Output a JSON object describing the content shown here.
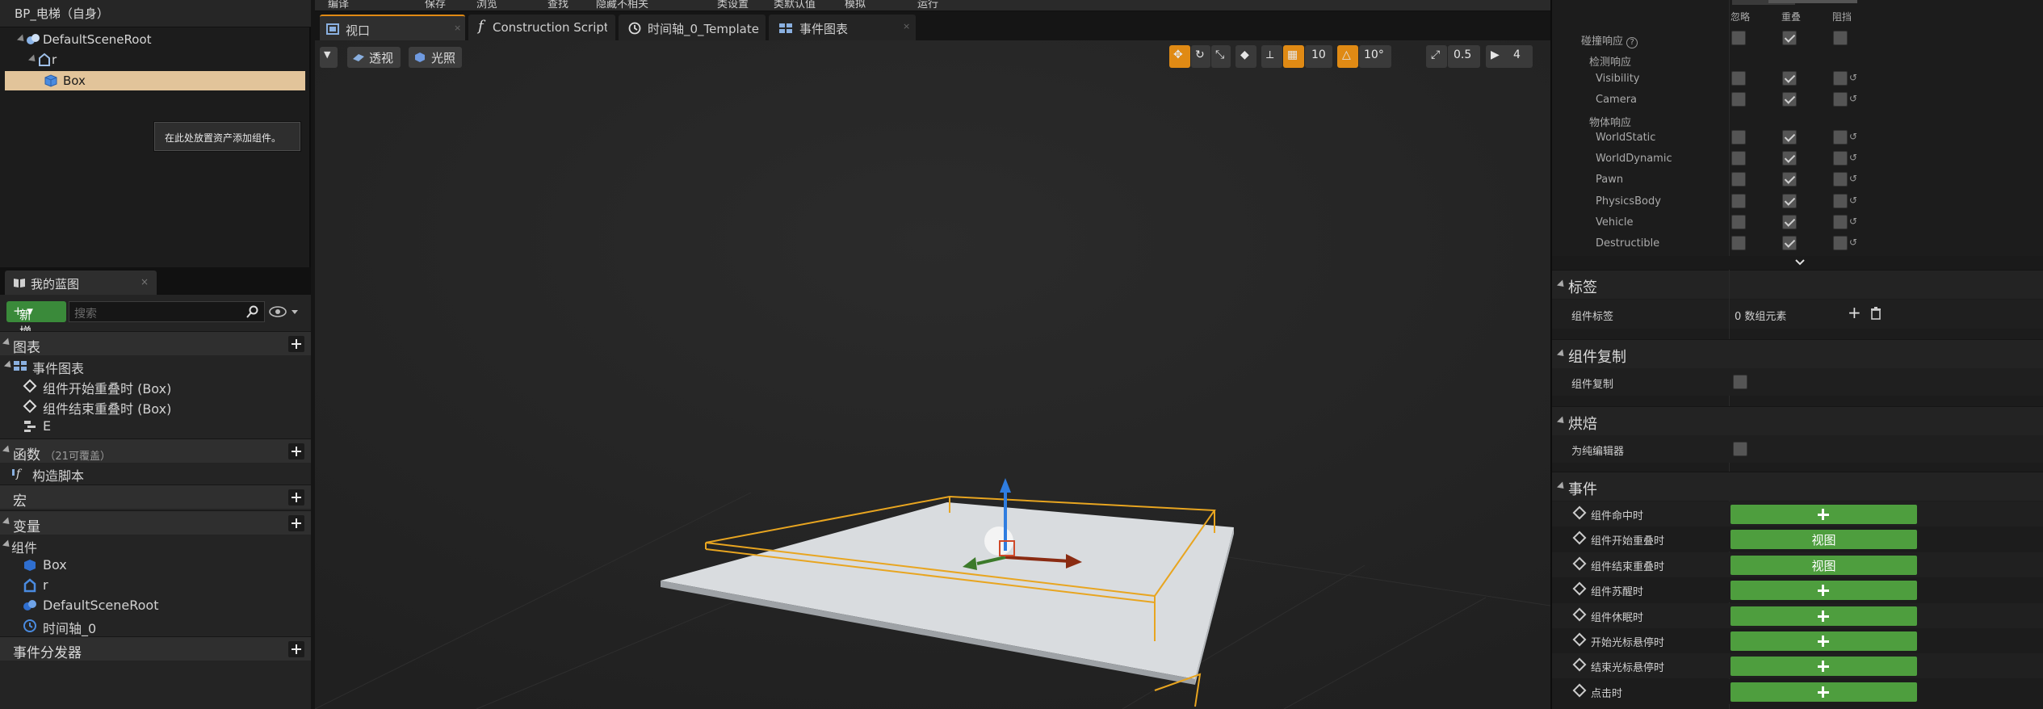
{
  "components_panel": {
    "root_label": "BP_电梯（自身）",
    "tree": [
      {
        "label": "DefaultSceneRoot",
        "icon": "scene-root-icon"
      },
      {
        "label": "r",
        "icon": "scene-component-icon"
      },
      {
        "label": "Box",
        "icon": "box-collision-icon",
        "selected": true
      }
    ],
    "hint": "在此处放置资产添加组件。"
  },
  "my_blueprint": {
    "tab_label": "我的蓝图",
    "new_button": "新增",
    "search_placeholder": "搜索",
    "sections": {
      "graphs": "图表",
      "event_graph": "事件图表",
      "graph_items": [
        "组件开始重叠时 (Box)",
        "组件结束重叠时 (Box)",
        "E"
      ],
      "functions": "函数",
      "functions_count": "（21可覆盖）",
      "construction_script": "构造脚本",
      "macros": "宏",
      "variables": "变量",
      "components": "组件",
      "component_items": [
        "Box",
        "r",
        "DefaultSceneRoot",
        "时间轴_0"
      ],
      "event_dispatchers": "事件分发器"
    }
  },
  "toolbar": {
    "items": [
      "编译",
      "保存",
      "浏览",
      "查找",
      "隐藏不相关",
      "类设置",
      "类默认值",
      "模拟",
      "运行"
    ]
  },
  "doc_tabs": [
    {
      "label": "视口",
      "icon": "viewport-icon"
    },
    {
      "label": "Construction Script",
      "icon": "function-icon"
    },
    {
      "label": "时间轴_0_Template",
      "icon": "timeline-icon"
    },
    {
      "label": "事件图表",
      "icon": "event-graph-icon"
    }
  ],
  "viewport": {
    "perspective": "透视",
    "lit": "光照",
    "grid_snap": "10",
    "rotation_snap": "10°",
    "scale_snap": "0.5",
    "camera_speed": "4"
  },
  "details": {
    "column_headers": [
      "忽略",
      "重叠",
      "阻挡"
    ],
    "collision_response": "碰撞响应",
    "trace_response": "检测响应",
    "trace_rows": [
      {
        "label": "Visibility",
        "ignore": false,
        "overlap": true,
        "block": false
      },
      {
        "label": "Camera",
        "ignore": false,
        "overlap": true,
        "block": false
      }
    ],
    "object_response": "物体响应",
    "object_rows": [
      {
        "label": "WorldStatic",
        "ignore": false,
        "overlap": true,
        "block": false
      },
      {
        "label": "WorldDynamic",
        "ignore": false,
        "overlap": true,
        "block": false
      },
      {
        "label": "Pawn",
        "ignore": false,
        "overlap": true,
        "block": false
      },
      {
        "label": "PhysicsBody",
        "ignore": false,
        "overlap": true,
        "block": false
      },
      {
        "label": "Vehicle",
        "ignore": false,
        "overlap": true,
        "block": false
      },
      {
        "label": "Destructible",
        "ignore": false,
        "overlap": true,
        "block": false
      }
    ],
    "tags_section": "标签",
    "component_tags_label": "组件标签",
    "component_tags_value": "0 数组元素",
    "replication_section": "组件复制",
    "replication_label": "组件复制",
    "cooking_section": "烘焙",
    "editor_only_label": "为纯编辑器",
    "events_section": "事件",
    "events": [
      {
        "label": "组件命中时",
        "button": "+"
      },
      {
        "label": "组件开始重叠时",
        "button": "视图"
      },
      {
        "label": "组件结束重叠时",
        "button": "视图"
      },
      {
        "label": "组件苏醒时",
        "button": "+"
      },
      {
        "label": "组件休眠时",
        "button": "+"
      },
      {
        "label": "开始光标悬停时",
        "button": "+"
      },
      {
        "label": "结束光标悬停时",
        "button": "+"
      },
      {
        "label": "点击时",
        "button": "+"
      }
    ]
  },
  "colors": {
    "accent_orange": "#e08a14",
    "add_green": "#4e9e3e",
    "selection": "#e2c49a",
    "bounds": "#e8a520"
  }
}
